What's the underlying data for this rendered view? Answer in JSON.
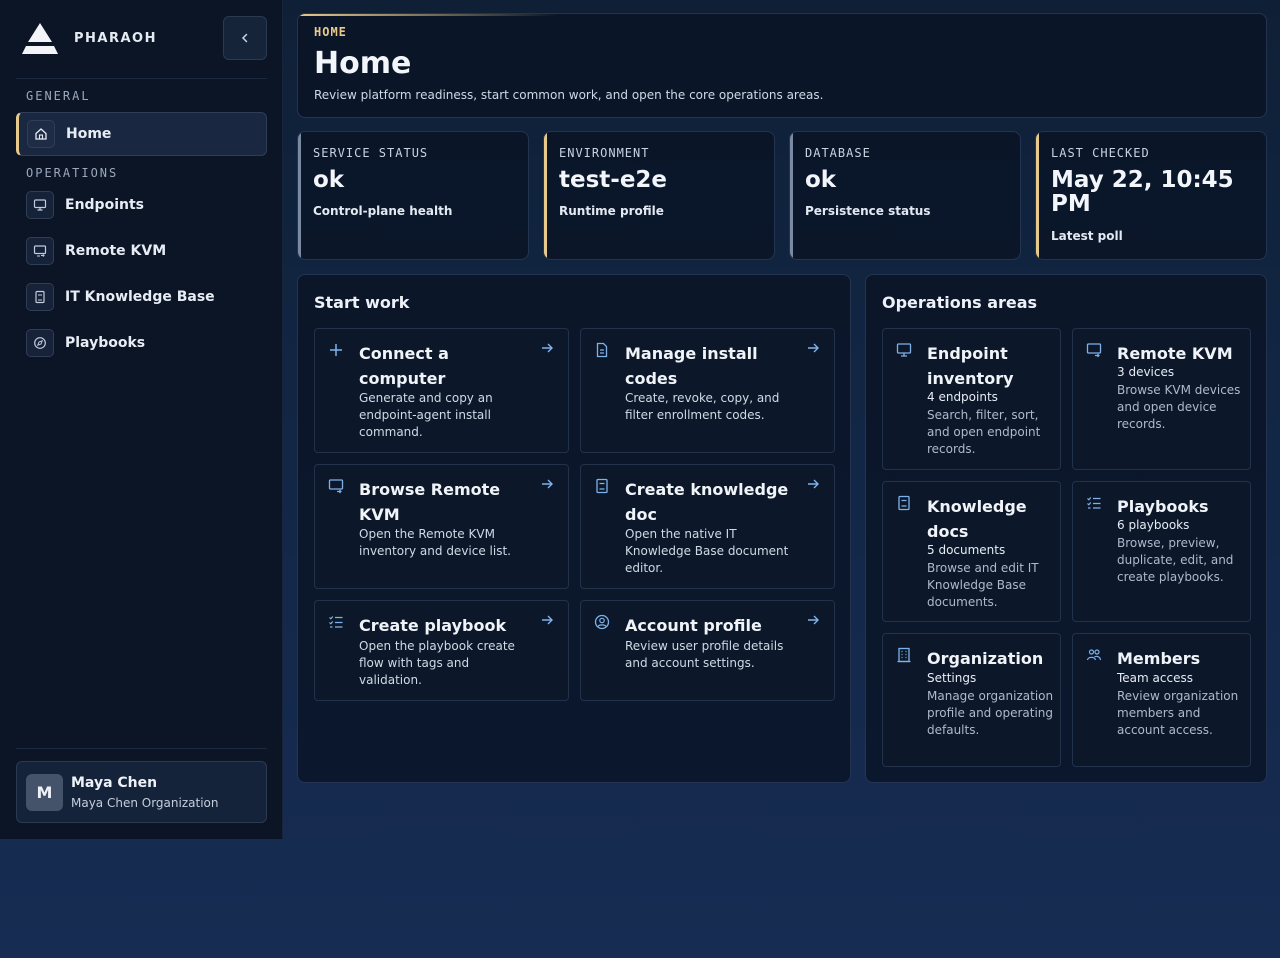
{
  "brand": {
    "name": "PHARAOH"
  },
  "sidebar": {
    "sections": [
      {
        "label": "GENERAL",
        "items": [
          {
            "label": "Home",
            "icon": "home-icon",
            "active": true
          }
        ]
      },
      {
        "label": "OPERATIONS",
        "items": [
          {
            "label": "Endpoints",
            "icon": "monitor-icon"
          },
          {
            "label": "Remote KVM",
            "icon": "screen-share-icon"
          },
          {
            "label": "IT Knowledge Base",
            "icon": "book-icon"
          },
          {
            "label": "Playbooks",
            "icon": "compass-icon"
          }
        ]
      }
    ],
    "user": {
      "initial": "M",
      "name": "Maya Chen",
      "org": "Maya Chen Organization"
    }
  },
  "hero": {
    "eyebrow": "HOME",
    "title": "Home",
    "description": "Review platform readiness, start common work, and open the core operations areas."
  },
  "stats": [
    {
      "key": "SERVICE STATUS",
      "value": "ok",
      "sub": "Control-plane health",
      "accent": "#7a8aa3"
    },
    {
      "key": "ENVIRONMENT",
      "value": "test-e2e",
      "sub": "Runtime profile",
      "accent": "#e8c98c"
    },
    {
      "key": "DATABASE",
      "value": "ok",
      "sub": "Persistence status",
      "accent": "#7a8aa3"
    },
    {
      "key": "LAST CHECKED",
      "value": "May 22, 10:45 PM",
      "sub": "Latest poll",
      "accent": "#e8c98c"
    }
  ],
  "start_work": {
    "title": "Start work",
    "cards": [
      {
        "title": "Connect a computer",
        "desc": "Generate and copy an endpoint-agent install command.",
        "icon": "plus-icon"
      },
      {
        "title": "Manage install codes",
        "desc": "Create, revoke, copy, and filter enrollment codes.",
        "icon": "document-icon"
      },
      {
        "title": "Browse Remote KVM",
        "desc": "Open the Remote KVM inventory and device list.",
        "icon": "screen-share-icon"
      },
      {
        "title": "Create knowledge doc",
        "desc": "Open the native IT Knowledge Base document editor.",
        "icon": "book-icon"
      },
      {
        "title": "Create playbook",
        "desc": "Open the playbook create flow with tags and validation.",
        "icon": "checklist-icon"
      },
      {
        "title": "Account profile",
        "desc": "Review user profile details and account settings.",
        "icon": "user-circle-icon"
      }
    ]
  },
  "operations": {
    "title": "Operations areas",
    "cards": [
      {
        "title": "Endpoint inventory",
        "meta": "4 endpoints",
        "desc": "Search, filter, sort, and open endpoint records.",
        "icon": "monitor-icon"
      },
      {
        "title": "Remote KVM",
        "meta": "3 devices",
        "desc": "Browse KVM devices and open device records.",
        "icon": "screen-share-icon"
      },
      {
        "title": "Knowledge docs",
        "meta": "5 documents",
        "desc": "Browse and edit IT Knowledge Base documents.",
        "icon": "book-icon"
      },
      {
        "title": "Playbooks",
        "meta": "6 playbooks",
        "desc": "Browse, preview, duplicate, edit, and create playbooks.",
        "icon": "checklist-icon"
      },
      {
        "title": "Organization",
        "meta": "Settings",
        "desc": "Manage organization profile and operating defaults.",
        "icon": "building-icon"
      },
      {
        "title": "Members",
        "meta": "Team access",
        "desc": "Review organization members and account access.",
        "icon": "users-icon"
      }
    ]
  },
  "colors": {
    "accent": "#e8c98c",
    "icon_blue": "#7fb2ea",
    "background": "#0f2036"
  }
}
